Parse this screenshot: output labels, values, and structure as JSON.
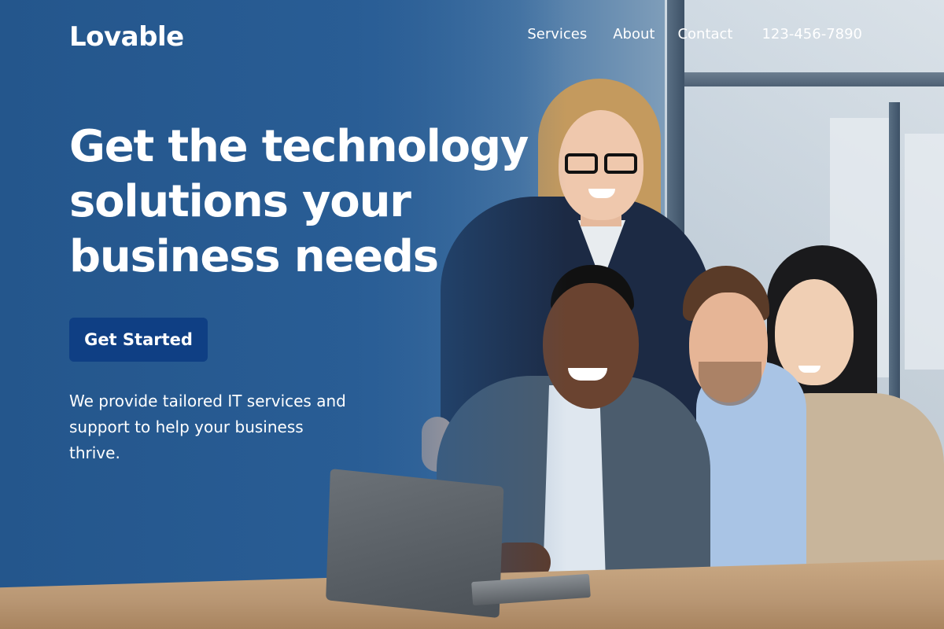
{
  "brand": {
    "name": "Lovable"
  },
  "nav": {
    "items": [
      {
        "label": "Services"
      },
      {
        "label": "About"
      },
      {
        "label": "Contact"
      }
    ],
    "phone": "123-456-7890"
  },
  "hero": {
    "title": "Get the technology solutions your business needs",
    "cta_label": "Get Started",
    "description": "We provide tailored IT services and support to help your business thrive."
  },
  "colors": {
    "background": "#2d5f93",
    "cta": "#0f3f84",
    "text": "#ffffff"
  },
  "image": {
    "subject": "team-photo"
  }
}
